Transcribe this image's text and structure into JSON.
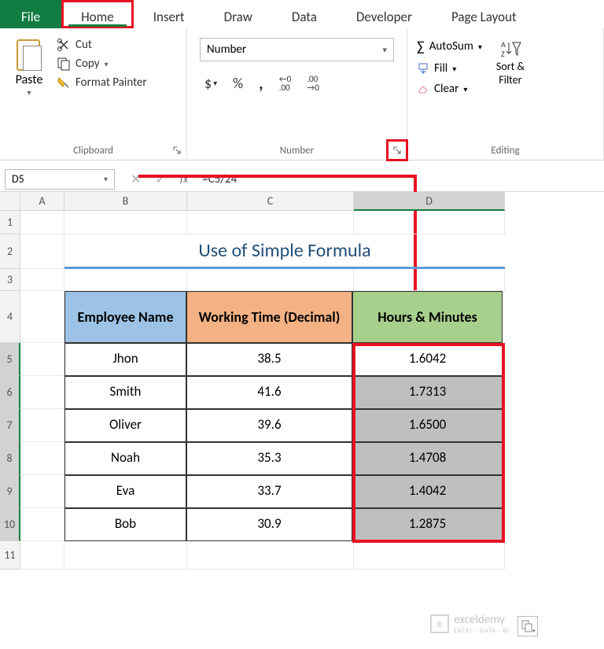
{
  "tabs": {
    "file": "File",
    "home": "Home",
    "insert": "Insert",
    "draw": "Draw",
    "data": "Data",
    "developer": "Developer",
    "page_layout": "Page Layout"
  },
  "clipboard": {
    "paste": "Paste",
    "cut": "Cut",
    "copy": "Copy",
    "format_painter": "Format Painter",
    "group_label": "Clipboard"
  },
  "number": {
    "format_value": "Number",
    "group_label": "Number"
  },
  "editing": {
    "autosum": "AutoSum",
    "fill": "Fill",
    "clear": "Clear",
    "sort_filter": "Sort &",
    "sort_filter2": "Filter",
    "group_label": "Editing"
  },
  "namebox": "D5",
  "formula": "=C5/24",
  "columns": [
    "A",
    "B",
    "C",
    "D"
  ],
  "rows": [
    "1",
    "2",
    "3",
    "4",
    "5",
    "6",
    "7",
    "8",
    "9",
    "10",
    "11"
  ],
  "title": "Use of Simple Formula",
  "table": {
    "headers": {
      "emp": "Employee Name",
      "wt": "Working Time (Decimal)",
      "hm": "Hours & Minutes"
    },
    "data": [
      {
        "emp": "Jhon",
        "wt": "38.5",
        "hm": "1.6042"
      },
      {
        "emp": "Smith",
        "wt": "41.6",
        "hm": "1.7313"
      },
      {
        "emp": "Oliver",
        "wt": "39.6",
        "hm": "1.6500"
      },
      {
        "emp": "Noah",
        "wt": "35.3",
        "hm": "1.4708"
      },
      {
        "emp": "Eva",
        "wt": "33.7",
        "hm": "1.4042"
      },
      {
        "emp": "Bob",
        "wt": "30.9",
        "hm": "1.2875"
      }
    ]
  },
  "watermark": {
    "brand": "exceldemy",
    "tagline": "EXCEL · DATA · BI"
  },
  "chart_data": {
    "type": "table",
    "title": "Use of Simple Formula",
    "columns": [
      "Employee Name",
      "Working Time (Decimal)",
      "Hours & Minutes"
    ],
    "rows": [
      [
        "Jhon",
        38.5,
        1.6042
      ],
      [
        "Smith",
        41.6,
        1.7313
      ],
      [
        "Oliver",
        39.6,
        1.65
      ],
      [
        "Noah",
        35.3,
        1.4708
      ],
      [
        "Eva",
        33.7,
        1.4042
      ],
      [
        "Bob",
        30.9,
        1.2875
      ]
    ]
  }
}
